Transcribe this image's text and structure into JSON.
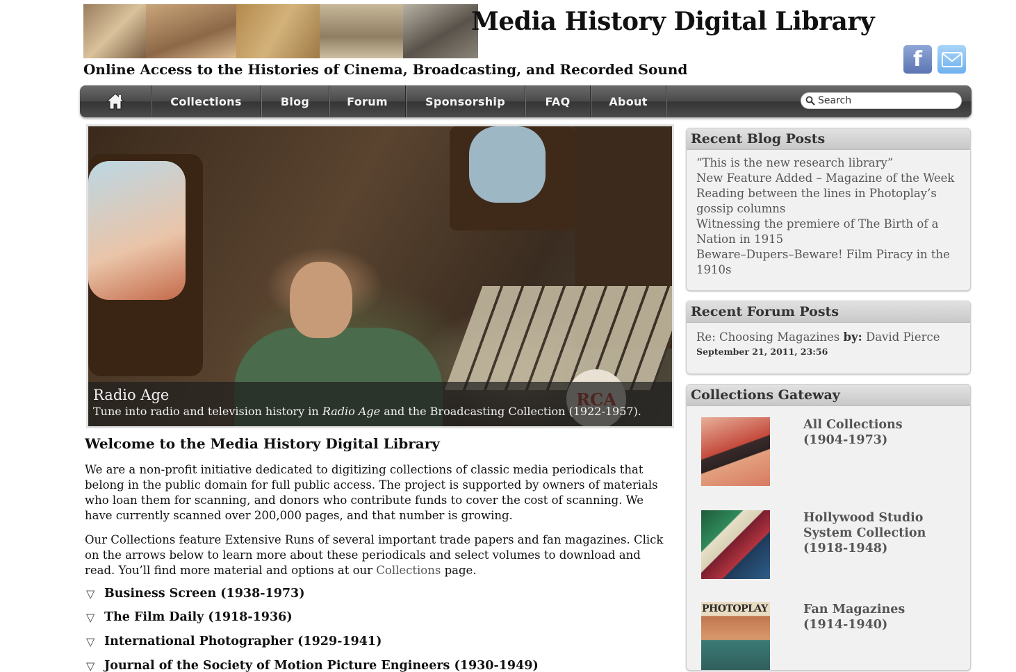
{
  "header": {
    "site_title": "Media History Digital Library",
    "tagline": "Online Access to the Histories of Cinema, Broadcasting, and Recorded Sound",
    "banner_icon": "collage-image"
  },
  "social": {
    "facebook_icon": "facebook-icon",
    "facebook_glyph": "f",
    "email_icon": "email-icon"
  },
  "nav": {
    "home_icon": "home-icon",
    "items": [
      "Collections",
      "Blog",
      "Forum",
      "Sponsorship",
      "FAQ",
      "About"
    ],
    "search_placeholder": "Search",
    "search_icon": "search-icon"
  },
  "hero": {
    "logo_text": "RCA",
    "caption_title": "Radio Age",
    "caption_prefix": "Tune into radio and television history in ",
    "caption_italic": "Radio Age",
    "caption_suffix": " and the Broadcasting Collection (1922-1957)."
  },
  "main": {
    "welcome_heading": "Welcome to the Media History Digital Library",
    "intro_paragraph": "We are a non-profit initiative dedicated to digitizing collections of classic media periodicals that belong in the public domain for full public access. The project is supported by owners of materials who loan them for scanning, and donors who contribute funds to cover the cost of scanning. We have currently scanned over 200,000 pages, and that number is growing.",
    "collections_paragraph_prefix": "Our Collections feature Extensive Runs of several important trade papers and fan magazines. Click on the arrows below to learn more about these periodicals and select volumes to download and read. You’ll find more material and options at our ",
    "collections_link": "Collections",
    "collections_paragraph_suffix": " page.",
    "expand_glyph": "▽",
    "periodicals": [
      "Business Screen (1938-1973)",
      "The Film Daily (1918-1936)",
      "International Photographer (1929-1941)",
      "Journal of the Society of Motion Picture Engineers (1930-1949)"
    ]
  },
  "sidebar": {
    "blog": {
      "title": "Recent Blog Posts",
      "posts": [
        "“This is the new research library”",
        "New Feature Added – Magazine of the Week",
        "Reading between the lines in Photoplay’s gossip columns",
        "Witnessing the premiere of The Birth of a Nation in 1915",
        "Beware–Dupers–Beware! Film Piracy in the 1910s"
      ]
    },
    "forum": {
      "title": "Recent Forum Posts",
      "post_title": "Re: Choosing Magazines",
      "by_label": "by:",
      "author": "David Pierce",
      "date": "September 21, 2011, 23:56"
    },
    "gateway": {
      "title": "Collections Gateway",
      "items": [
        {
          "name": "All Collections",
          "years": "(1904-1973)"
        },
        {
          "name": "Hollywood Studio System Collection",
          "years": "(1918-1948)"
        },
        {
          "name": "Fan Magazines",
          "years": "(1914-1940)"
        }
      ],
      "photoplay_text": "PHOTOPLAY"
    }
  }
}
